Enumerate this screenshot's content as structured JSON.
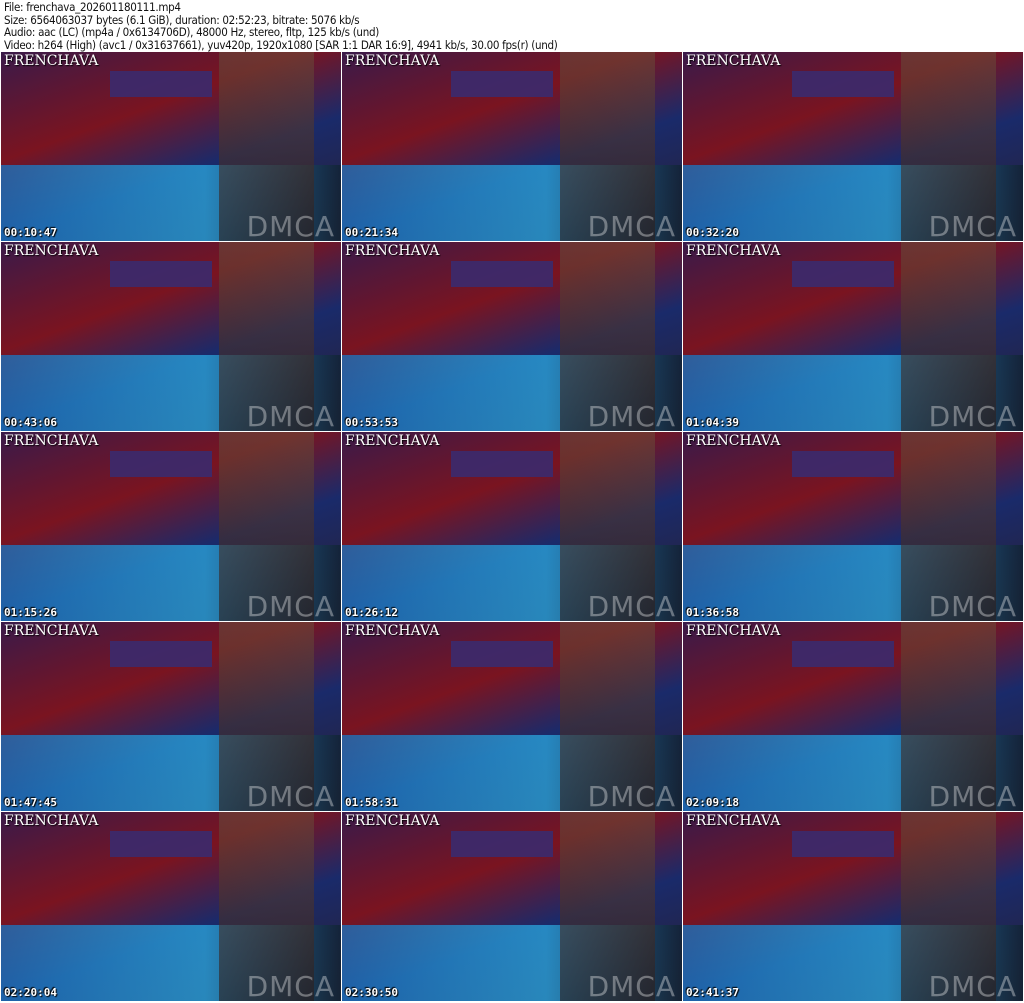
{
  "header": {
    "file": "File: frenchava_202601180111.mp4",
    "size": "Size: 6564063037 bytes (6.1 GiB), duration: 02:52:23, bitrate: 5076 kb/s",
    "audio": "Audio: aac (LC) (mp4a / 0x6134706D), 48000 Hz, stereo, fltp, 125 kb/s (und)",
    "video": "Video: h264 (High) (avc1 / 0x31637661), yuv420p, 1920x1080 [SAR 1:1 DAR 16:9], 4941 kb/s, 30.00 fps(r) (und)"
  },
  "watermark": "FRENCHAVA",
  "dmca": "DMCA",
  "timestamps": [
    "00:10:47",
    "00:21:34",
    "00:32:20",
    "00:43:06",
    "00:53:53",
    "01:04:39",
    "01:15:26",
    "01:26:12",
    "01:36:58",
    "01:47:45",
    "01:58:31",
    "02:09:18",
    "02:20:04",
    "02:30:50",
    "02:41:37"
  ]
}
